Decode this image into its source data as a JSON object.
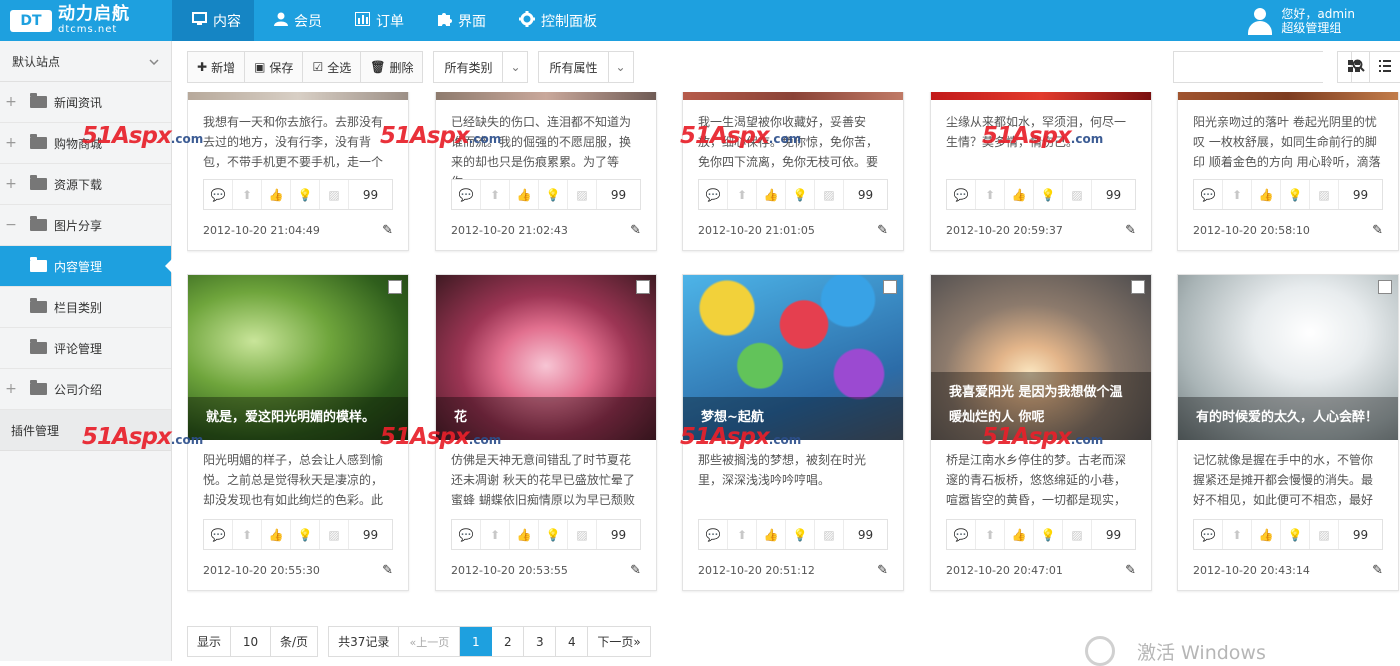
{
  "header": {
    "logo_badge": "DT",
    "logo_cn": "动力启航",
    "logo_en": "dtcms.net",
    "nav": [
      {
        "label": "内容",
        "icon": "monitor-icon"
      },
      {
        "label": "会员",
        "icon": "user-icon"
      },
      {
        "label": "订单",
        "icon": "chart-icon"
      },
      {
        "label": "界面",
        "icon": "puzzle-icon"
      },
      {
        "label": "控制面板",
        "icon": "gear-icon"
      }
    ],
    "user_greeting": "您好，admin",
    "user_role": "超级管理组"
  },
  "sidebar": {
    "site": "默认站点",
    "items": [
      {
        "label": "新闻资讯"
      },
      {
        "label": "购物商城"
      },
      {
        "label": "资源下载"
      },
      {
        "label": "图片分享"
      },
      {
        "label": "内容管理"
      },
      {
        "label": "栏目类别"
      },
      {
        "label": "评论管理"
      },
      {
        "label": "公司介绍"
      }
    ],
    "plugin": "插件管理"
  },
  "toolbar": {
    "add": "新增",
    "save": "保存",
    "select_all": "全选",
    "delete": "删除",
    "category": "所有类别",
    "attribute": "所有属性"
  },
  "cards": [
    {
      "desc": "我想有一天和你去旅行。去那没有去过的地方，没有行李，没有背包，不带手机更不要手机，走一个",
      "count": "99",
      "time": "2012-10-20 21:04:49",
      "liked": false
    },
    {
      "desc": "已经缺失的伤口、连泪都不知道为谁而流。我的倔强的不愿屈服，换来的却也只是伤痕累累。为了等你，",
      "count": "99",
      "time": "2012-10-20 21:02:43",
      "liked": false
    },
    {
      "desc": "我一生渴望被你收藏好，妥善安放，细心保存。免你惊，免你苦，免你四下流离，免你无枝可依。要",
      "count": "99",
      "time": "2012-10-20 21:01:05",
      "liked": true
    },
    {
      "desc": "尘缘从来都如水，罕须泪，何尽一生情？莫多情，情伤己。",
      "count": "99",
      "time": "2012-10-20 20:59:37",
      "liked": true
    },
    {
      "desc": "阳光亲吻过的落叶 卷起光阴里的忧叹 一枚枚舒展，如同生命前行的脚印 顺着金色的方向 用心聆听，滴落",
      "count": "99",
      "time": "2012-10-20 20:58:10",
      "liked": false
    },
    {
      "caption": "就是，爱这阳光明媚的模样。",
      "desc": "阳光明媚的样子，总会让人感到愉悦。之前总是觉得秋天是凄凉的，却没发现也有如此绚烂的色彩。此",
      "count": "99",
      "time": "2012-10-20 20:55:30",
      "liked": true
    },
    {
      "caption": "花",
      "desc": "仿佛是天神无意间错乱了时节夏花还未凋谢 秋天的花早已盛放忙晕了蜜蜂 蝴蝶依旧痴情原以为早已颓败",
      "count": "99",
      "time": "2012-10-20 20:53:55",
      "liked": true
    },
    {
      "caption": "梦想~起航",
      "desc": "那些被搁浅的梦想，被刻在时光里，深深浅浅吟吟哼唱。",
      "count": "99",
      "time": "2012-10-20 20:51:12",
      "liked": true
    },
    {
      "caption": "我喜爱阳光 是因为我想做个温暖灿烂的人 你呢",
      "desc": "桥是江南水乡停住的梦。古老而深邃的青石板桥，悠悠绵延的小巷，喧嚣皆空的黄昏，一切都是现实，",
      "count": "99",
      "time": "2012-10-20 20:47:01",
      "liked": true
    },
    {
      "caption": "有的时候爱的太久，人心会醉！",
      "desc": "记忆就像是握在手中的水，不管你握紧还是摊开都会慢慢的消失。最好不相见，如此便可不相恋，最好",
      "count": "99",
      "time": "2012-10-20 20:43:14",
      "liked": true
    }
  ],
  "pager": {
    "show": "显示",
    "page_size": "10",
    "per_page": "条/页",
    "total": "共37记录",
    "prev": "«上一页",
    "pages": [
      "1",
      "2",
      "3",
      "4"
    ],
    "current": "1",
    "next": "下一页»"
  },
  "watermark": {
    "brand": "51Aspx",
    "suffix": ".com"
  },
  "os_notice": "激活 Windows"
}
